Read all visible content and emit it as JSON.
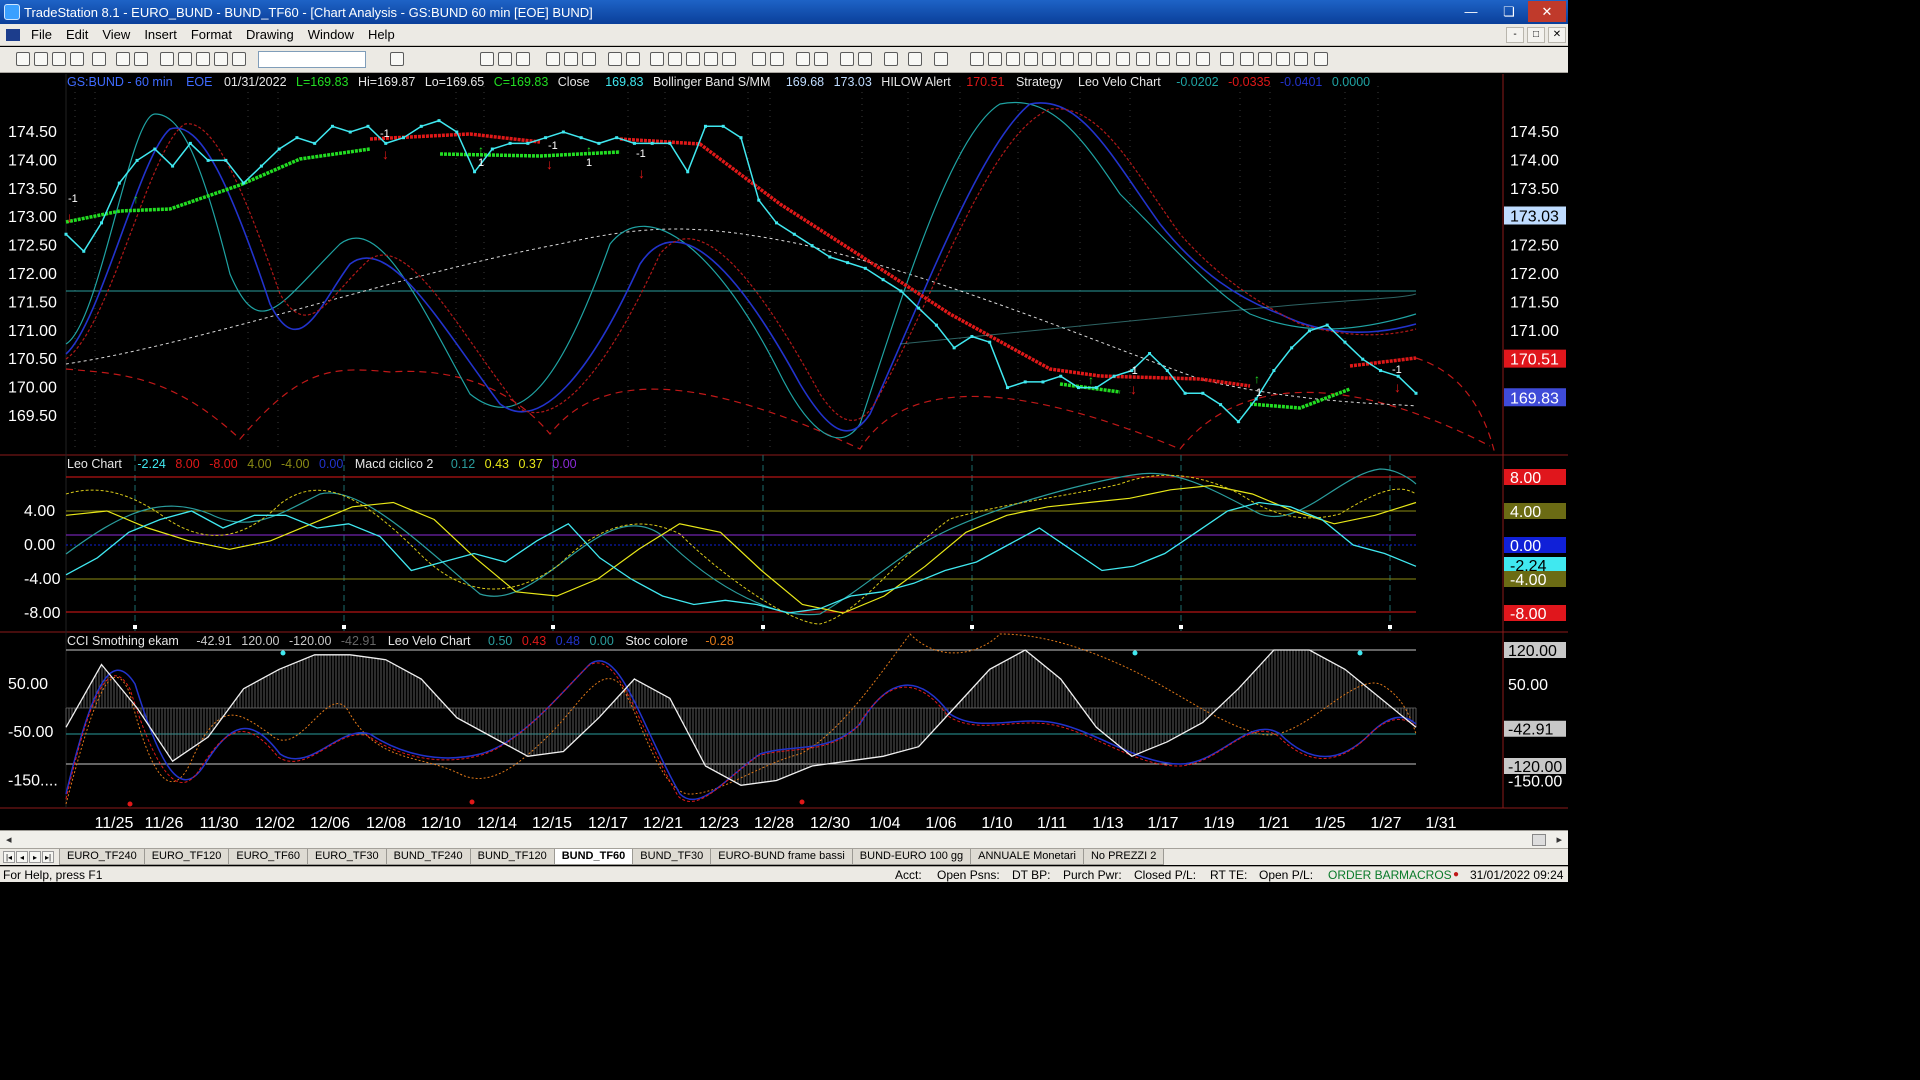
{
  "window": {
    "title": "TradeStation 8.1 - EURO_BUND - BUND_TF60 - [Chart Analysis - GS:BUND  60 min  [EOE] BUND]",
    "minimize": "—",
    "restore": "❏",
    "close": "✕"
  },
  "menu": [
    "File",
    "Edit",
    "View",
    "Insert",
    "Format",
    "Drawing",
    "Window",
    "Help"
  ],
  "mdi_buttons": [
    "-",
    "□",
    "✕"
  ],
  "header": {
    "symbol": "GS:BUND - 60 min",
    "session": "EOE",
    "date": "01/31/2022",
    "low_label": "L=169.83",
    "high_label": "Hi=169.87",
    "lo_label": "Lo=169.65",
    "close_label": "C=169.83",
    "close_word": "Close",
    "close_value": "169.83",
    "bb_name": "Bollinger Band S/MM",
    "bb_v1": "169.68",
    "bb_v2": "173.03",
    "hilow_name": "HILOW Alert",
    "hilow_value": "170.51",
    "strategy_name": "Strategy",
    "velo_name": "Leo Velo Chart",
    "velo_v1": "-0.0202",
    "velo_v2": "-0.0335",
    "velo_v3": "-0.0401",
    "velo_v4": "0.0000"
  },
  "panel2_header": {
    "name": "Leo Chart",
    "v1": "-2.24",
    "v2": "8.00",
    "v3": "-8.00",
    "v4": "4.00",
    "v5": "-4.00",
    "v6": "0.00",
    "macd_name": "Macd ciclico 2",
    "m1": "0.12",
    "m2": "0.43",
    "m3": "0.37",
    "m4": "0.00"
  },
  "panel3_header": {
    "name": "CCI Smothing ekam",
    "v1": "-42.91",
    "v2": "120.00",
    "v3": "-120.00",
    "v4": "-42.91",
    "velo_name": "Leo Velo Chart",
    "w1": "0.50",
    "w2": "0.43",
    "w3": "0.48",
    "w4": "0.00",
    "stoc_name": "Stoc colore",
    "s1": "-0.28"
  },
  "price_axis": {
    "ticks": [
      "174.50",
      "174.00",
      "173.50",
      "173.00",
      "172.50",
      "172.00",
      "171.50",
      "171.00",
      "170.50",
      "170.00",
      "169.50"
    ],
    "ticks_values": [
      174.5,
      174.0,
      173.5,
      173.0,
      172.5,
      172.0,
      171.5,
      171.0,
      170.5,
      170.0,
      169.5
    ],
    "left_ticks": [
      "174.50",
      "174.00",
      "173.50",
      "173.00",
      "172.50",
      "172.00",
      "171.50",
      "171.00",
      "170.50",
      "170.00",
      "169.50"
    ],
    "badges": [
      {
        "label": "173.03",
        "value": 173.03,
        "bg": "#bfdcff",
        "fg": "#000000"
      },
      {
        "label": "170.51",
        "value": 170.51,
        "bg": "#e0161c",
        "fg": "#ffffff"
      },
      {
        "label": "169.83",
        "value": 169.83,
        "bg": "#3f4bd8",
        "fg": "#ffffff"
      }
    ],
    "partial_labels": [
      "170.00",
      "169.50"
    ]
  },
  "osc_axis": {
    "ticks": [
      "4.00",
      "0.00",
      "-4.00",
      "-8.00"
    ],
    "ticks_values": [
      4,
      0,
      -4,
      -8
    ],
    "badges": [
      {
        "label": "8.00",
        "value": 8,
        "bg": "#e0161c",
        "fg": "#ffffff"
      },
      {
        "label": "4.00",
        "value": 4,
        "bg": "#6b6b14",
        "fg": "#ffffff"
      },
      {
        "label": "0.00",
        "value": 0,
        "bg": "#1020d8",
        "fg": "#ffffff"
      },
      {
        "label": "-2.24",
        "value": -2.24,
        "bg": "#40e8f0",
        "fg": "#000000"
      },
      {
        "label": "-4.00",
        "value": -4,
        "bg": "#6b6b14",
        "fg": "#ffffff"
      },
      {
        "label": "-8.00",
        "value": -8,
        "bg": "#e0161c",
        "fg": "#ffffff"
      }
    ]
  },
  "cci_axis": {
    "ticks": [
      "50.00",
      "-50.00",
      "-150...."
    ],
    "ticks_values": [
      50,
      -50,
      -150
    ],
    "badges": [
      {
        "label": "120.00",
        "value": 120,
        "bg": "#c8c8c8",
        "fg": "#000000"
      },
      {
        "label": "50.00",
        "value": 50,
        "bg": "none",
        "fg": "#ffffff"
      },
      {
        "label": "-42.91",
        "value": -42.91,
        "bg": "#c8c8c8",
        "fg": "#000000"
      },
      {
        "label": "-120.00",
        "value": -120,
        "bg": "#c8c8c8",
        "fg": "#000000"
      },
      {
        "label": "-150.00",
        "value": -150,
        "bg": "none",
        "fg": "#ffffff"
      }
    ]
  },
  "x_labels": [
    "11/25",
    "11/26",
    "11/30",
    "12/02",
    "12/06",
    "12/08",
    "12/10",
    "12/14",
    "12/15",
    "12/17",
    "12/21",
    "12/23",
    "12/28",
    "12/30",
    "1/04",
    "1/06",
    "1/10",
    "1/11",
    "1/13",
    "1/17",
    "1/19",
    "1/21",
    "1/25",
    "1/27",
    "1/31"
  ],
  "chart_data": {
    "type": "line",
    "price": {
      "title": "GS:BUND - 60 min",
      "ylim": [
        169.2,
        175.2
      ],
      "close": [
        172.7,
        172.4,
        172.9,
        173.6,
        174.0,
        174.2,
        173.9,
        174.3,
        174.0,
        174.0,
        173.6,
        173.9,
        174.2,
        174.4,
        174.3,
        174.6,
        174.5,
        174.6,
        174.3,
        174.4,
        174.6,
        174.7,
        174.5,
        173.8,
        174.2,
        174.3,
        174.3,
        174.4,
        174.5,
        174.4,
        174.3,
        174.4,
        174.3,
        174.3,
        174.3,
        173.8,
        174.6,
        174.6,
        174.4,
        173.3,
        172.9,
        172.7,
        172.5,
        172.3,
        172.2,
        172.1,
        171.9,
        171.7,
        171.4,
        171.1,
        170.7,
        170.9,
        170.8,
        170.0,
        170.1,
        170.1,
        170.2,
        170.0,
        170.0,
        170.2,
        170.3,
        170.6,
        170.3,
        169.9,
        169.9,
        169.7,
        169.4,
        169.8,
        170.3,
        170.7,
        171.0,
        171.1,
        170.8,
        170.5,
        170.3,
        170.2,
        169.9
      ],
      "hilow_alert": [
        173.2,
        173.3,
        173.0,
        172.9,
        172.9,
        173.1,
        173.3,
        173.6,
        173.8,
        174.0,
        174.0,
        174.1,
        174.2,
        174.3,
        174.3,
        174.3,
        174.3,
        174.3,
        174.3,
        174.3,
        174.3,
        174.4,
        174.4,
        174.3,
        174.2,
        174.0,
        173.8,
        173.4,
        173.0,
        172.6,
        172.2,
        171.8,
        171.4,
        171.1,
        170.8,
        170.6,
        170.4,
        170.3,
        170.2,
        170.1,
        170.1,
        170.1,
        170.0,
        169.8,
        169.8,
        170.0,
        170.1,
        170.1,
        170.2,
        170.3,
        170.4,
        170.5
      ],
      "bollinger_upper": [
        170.4,
        170.5,
        170.7,
        170.9,
        171.2,
        171.5,
        171.9,
        172.3,
        172.6,
        172.8,
        172.8,
        172.7,
        172.4,
        172.0,
        171.6,
        171.2,
        170.9,
        170.6,
        170.4,
        170.2,
        170.1,
        170.0,
        169.9,
        169.8
      ],
      "bollinger_lower": [
        172.9,
        173.1,
        173.3,
        173.6,
        173.8,
        174.0,
        174.2,
        174.4,
        174.5,
        174.5,
        174.5,
        174.4,
        174.3,
        174.1,
        173.8,
        173.5,
        173.2,
        173.0
      ]
    },
    "leo_chart": {
      "ylim": [
        -10,
        10
      ],
      "velo": [
        -3.5,
        -1.5,
        1.5,
        3.0,
        4.0,
        2.0,
        3.5,
        3.5,
        2.0,
        2.5,
        1.0,
        -3.0,
        -2.0,
        -1.0,
        -2.0,
        0.5,
        2.5,
        -1.5,
        -4.0,
        -6.0,
        -7.0,
        -6.5,
        -7.0,
        -8.0,
        -7.5,
        -6.0,
        -5.5,
        -4.5,
        -3.0,
        -2.0,
        0.0,
        2.0,
        -0.5,
        -3.0,
        -2.5,
        -1.0,
        1.5,
        4.0,
        5.0,
        4.5,
        3.0,
        0.0,
        -1.0,
        -2.5
      ],
      "macd": [
        3.5,
        4.0,
        2.0,
        0.5,
        -0.5,
        0.5,
        2.5,
        4.5,
        5.0,
        3.0,
        -1.5,
        -5.5,
        -6.0,
        -4.0,
        -0.5,
        2.5,
        1.5,
        -3.0,
        -7.0,
        -8.0,
        -6.0,
        -2.5,
        1.5,
        3.5,
        4.5,
        5.0,
        5.5,
        6.5,
        7.0,
        6.0,
        4.0,
        2.5,
        3.5,
        5.0
      ]
    },
    "cci": {
      "ylim": [
        -190,
        150
      ],
      "cci": [
        -40,
        90,
        0,
        -110,
        -60,
        40,
        80,
        110,
        110,
        100,
        60,
        -20,
        -60,
        -100,
        -90,
        -20,
        60,
        20,
        -120,
        -160,
        -150,
        -120,
        -110,
        -100,
        -80,
        0,
        80,
        120,
        60,
        -40,
        -100,
        -70,
        -30,
        40,
        120,
        120,
        80,
        20,
        -40
      ]
    }
  }
}
